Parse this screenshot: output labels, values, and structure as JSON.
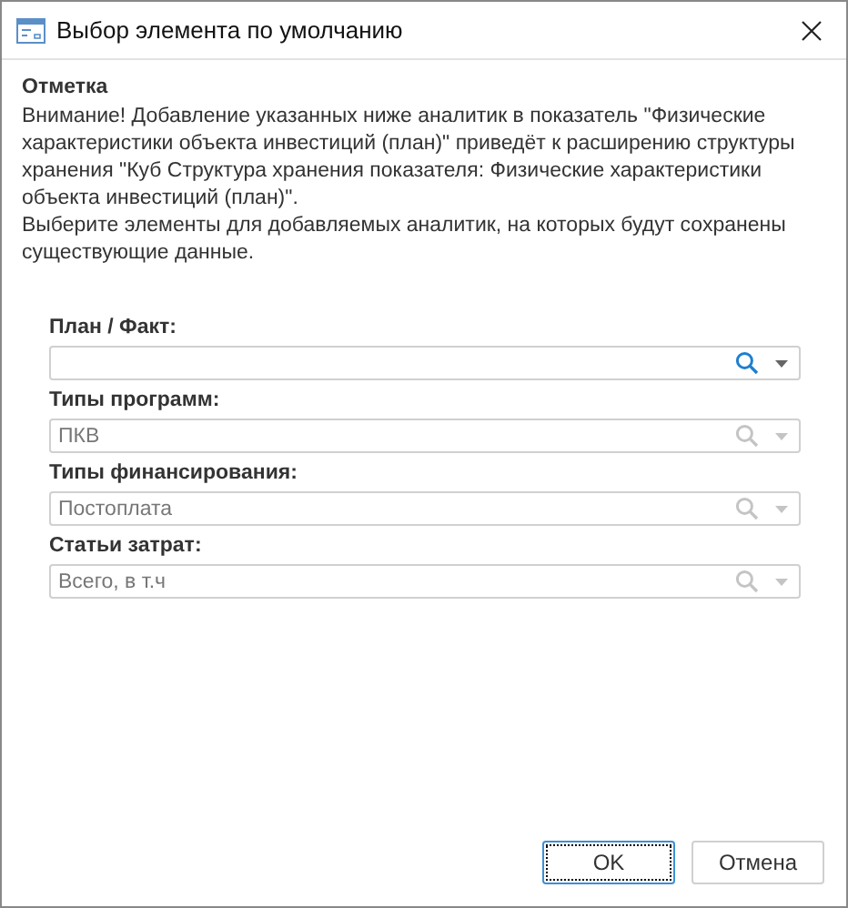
{
  "window": {
    "title": "Выбор элемента по умолчанию"
  },
  "notice": {
    "heading": "Отметка",
    "paragraphs": [
      "Внимание! Добавление указанных ниже аналитик в показатель \"Физические характеристики объекта инвестиций (план)\" приведёт к расширению структуры хранения \"Куб Структура хранения показателя: Физические характеристики объекта инвестиций (план)\".",
      "Выберите элементы для добавляемых аналитик, на которых будут сохранены существующие данные."
    ]
  },
  "fields": [
    {
      "label": "План / Факт:",
      "disabled": false
    },
    {
      "label": "Типы программ:",
      "value": "ПКВ",
      "disabled": true
    },
    {
      "label": "Типы финансирования:",
      "value": "Постоплата",
      "disabled": true
    },
    {
      "label": "Статьи затрат:",
      "value": "Всего, в т.ч",
      "disabled": true
    }
  ],
  "buttons": [
    {
      "label": "OK",
      "focused": true
    },
    {
      "label": "Отмена",
      "focused": false
    }
  ]
}
